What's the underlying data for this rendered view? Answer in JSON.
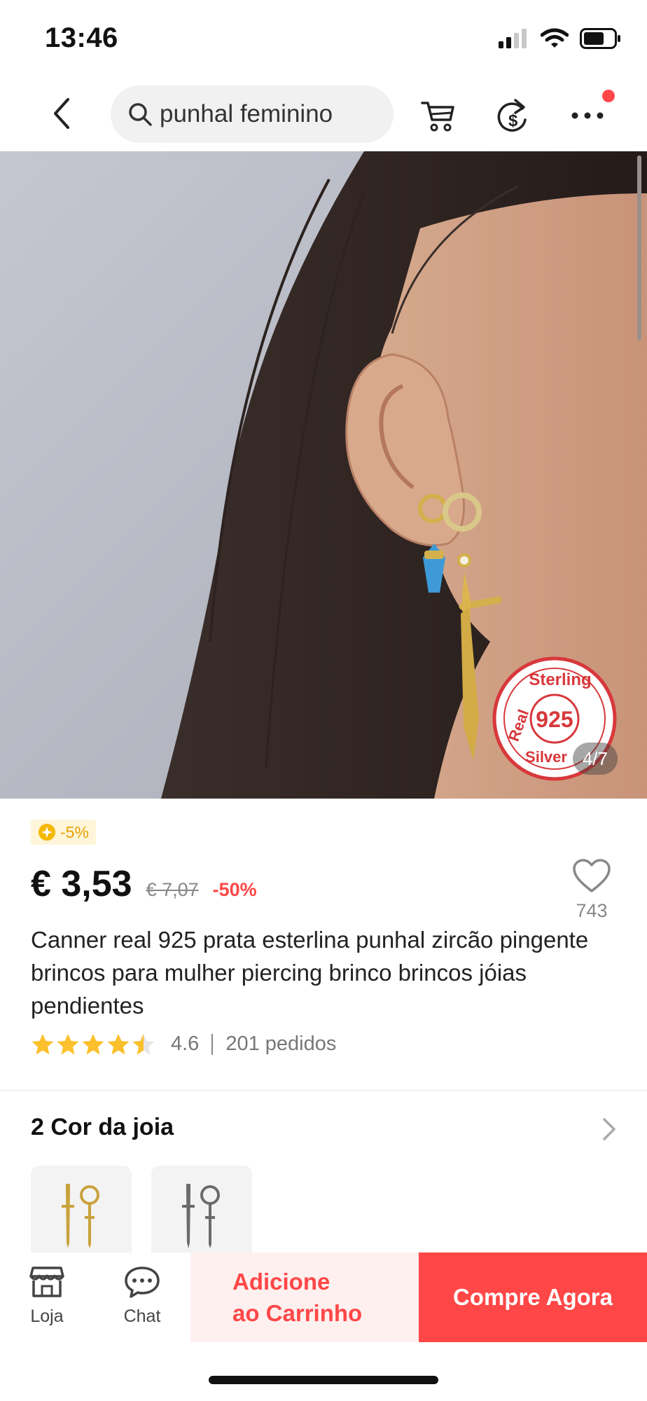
{
  "status_bar": {
    "time": "13:46"
  },
  "nav": {
    "search_text": "punhal feminino",
    "icons": [
      "back-icon",
      "search-icon",
      "cart-icon",
      "coin-share-icon",
      "more-icon"
    ]
  },
  "gallery": {
    "counter": "4/7",
    "watermark": {
      "line1": "Sterling",
      "line2": "Real",
      "number": "925",
      "line3": "Silver"
    }
  },
  "pricing": {
    "coin_discount": "-5%",
    "price": "€ 3,53",
    "original_price": "€ 7,07",
    "discount": "-50%",
    "wishlist_count": "743"
  },
  "product": {
    "title": "Canner real 925 prata esterlina punhal zircão pingente brincos para mulher piercing brinco brincos jóias pendientes",
    "rating": "4.6",
    "stars": 4.5,
    "orders": "201 pedidos"
  },
  "variants": {
    "title": "2 Cor da joia",
    "options": [
      "gold",
      "silver"
    ]
  },
  "bottom_bar": {
    "store_label": "Loja",
    "chat_label": "Chat",
    "add_cart_line1": "Adicione",
    "add_cart_line2": "ao Carrinho",
    "buy_now": "Compre Agora"
  },
  "colors": {
    "accent": "#ff4747",
    "coin": "#f5b800",
    "star": "#fcc02d"
  }
}
